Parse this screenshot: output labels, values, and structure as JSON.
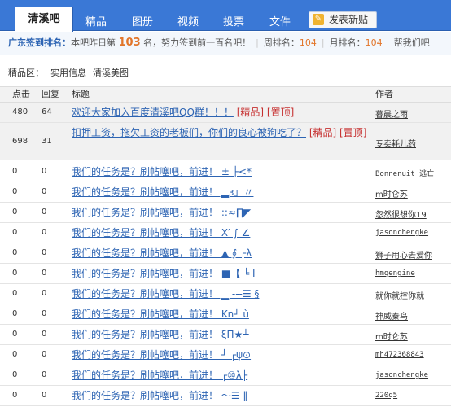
{
  "tabs": [
    {
      "label": "清溪吧",
      "active": true
    },
    {
      "label": "精品"
    },
    {
      "label": "图册"
    },
    {
      "label": "视频"
    },
    {
      "label": "投票"
    },
    {
      "label": "文件"
    }
  ],
  "post_button": {
    "label": "发表新贴",
    "icon": "pencil-icon"
  },
  "sign_bar": {
    "rank_label": "广东签到排名：",
    "rank_text_1": "本吧昨日第",
    "rank_value": "103",
    "rank_text_2": "名，努力签到前一百名吧！",
    "week_label": "周排名：",
    "week_value": "104",
    "month_label": "月排名：",
    "month_value": "104",
    "help_text": "帮我们吧"
  },
  "breadcrumbs": {
    "label": "精品区：",
    "links": [
      "实用信息",
      "清溪美图"
    ]
  },
  "table": {
    "headers": {
      "clicks": "点击",
      "replies": "回复",
      "title": "标题",
      "author": "作者"
    },
    "rows": [
      {
        "clicks": "480",
        "replies": "64",
        "title": "欢迎大家加入百度清溪吧QQ群！！！",
        "tags": "[精品] [置顶]",
        "author": "暮晨之雨"
      },
      {
        "clicks": "698",
        "replies": "31",
        "title": "扣押工资，拖欠工资的老板们，你们的良心被狗吃了？",
        "tags": "[精品] [置顶]",
        "author": "专卖耗儿药"
      },
      {
        "clicks": "0",
        "replies": "0",
        "title": "我们的任务是？刷帖噻吧，前进！ ± ├<*",
        "tags": "",
        "author": "Bonnenuit_逃亡"
      },
      {
        "clicks": "0",
        "replies": "0",
        "title": "我们的任务是？刷帖噻吧，前进！ ▂з」〃",
        "tags": "",
        "author": "m时仑苏"
      },
      {
        "clicks": "0",
        "replies": "0",
        "title": "我们的任务是？刷帖噻吧，前进！ ::≈∏◤",
        "tags": "",
        "author": "忽然很想你19"
      },
      {
        "clicks": "0",
        "replies": "0",
        "title": "我们的任务是？刷帖噻吧，前进！ Ⅹ′ ∫ ∠",
        "tags": "",
        "author": "jasonchengke"
      },
      {
        "clicks": "0",
        "replies": "0",
        "title": "我们的任务是？刷帖噻吧，前进！ ▲ ∮ ┌λ",
        "tags": "",
        "author": "狮子用心去爱你"
      },
      {
        "clicks": "0",
        "replies": "0",
        "title": "我们的任务是？刷帖噻吧，前进！ ■【 ╘ I",
        "tags": "",
        "author": "hmqengine"
      },
      {
        "clicks": "0",
        "replies": "0",
        "title": "我们的任务是？刷帖噻吧，前进！ ▁ ---☰ §",
        "tags": "",
        "author": "就你就控你就"
      },
      {
        "clicks": "0",
        "replies": "0",
        "title": "我们的任务是？刷帖噻吧，前进！ Kn┘ ù",
        "tags": "",
        "author": "神威秦鸟"
      },
      {
        "clicks": "0",
        "replies": "0",
        "title": "我们的任务是？刷帖噻吧，前进！ ξΠ★┷",
        "tags": "",
        "author": "m时仑苏"
      },
      {
        "clicks": "0",
        "replies": "0",
        "title": "我们的任务是？刷帖噻吧，前进！ ┘ ┌ψ⊙",
        "tags": "",
        "author": "mh472368843"
      },
      {
        "clicks": "0",
        "replies": "0",
        "title": "我们的任务是？刷帖噻吧，前进！ ┌⑩λ├",
        "tags": "",
        "author": "jasonchengke"
      },
      {
        "clicks": "0",
        "replies": "0",
        "title": "我们的任务是？刷帖噻吧，前进！ ～☰ ‖",
        "tags": "",
        "author": "220q5"
      }
    ]
  },
  "colors": {
    "tab_bar": "#3a78d6",
    "link": "#2d64b3",
    "tag": "#c62f2f",
    "rank_number": "#e2762b",
    "sticky_row": "#f1f1f1"
  }
}
